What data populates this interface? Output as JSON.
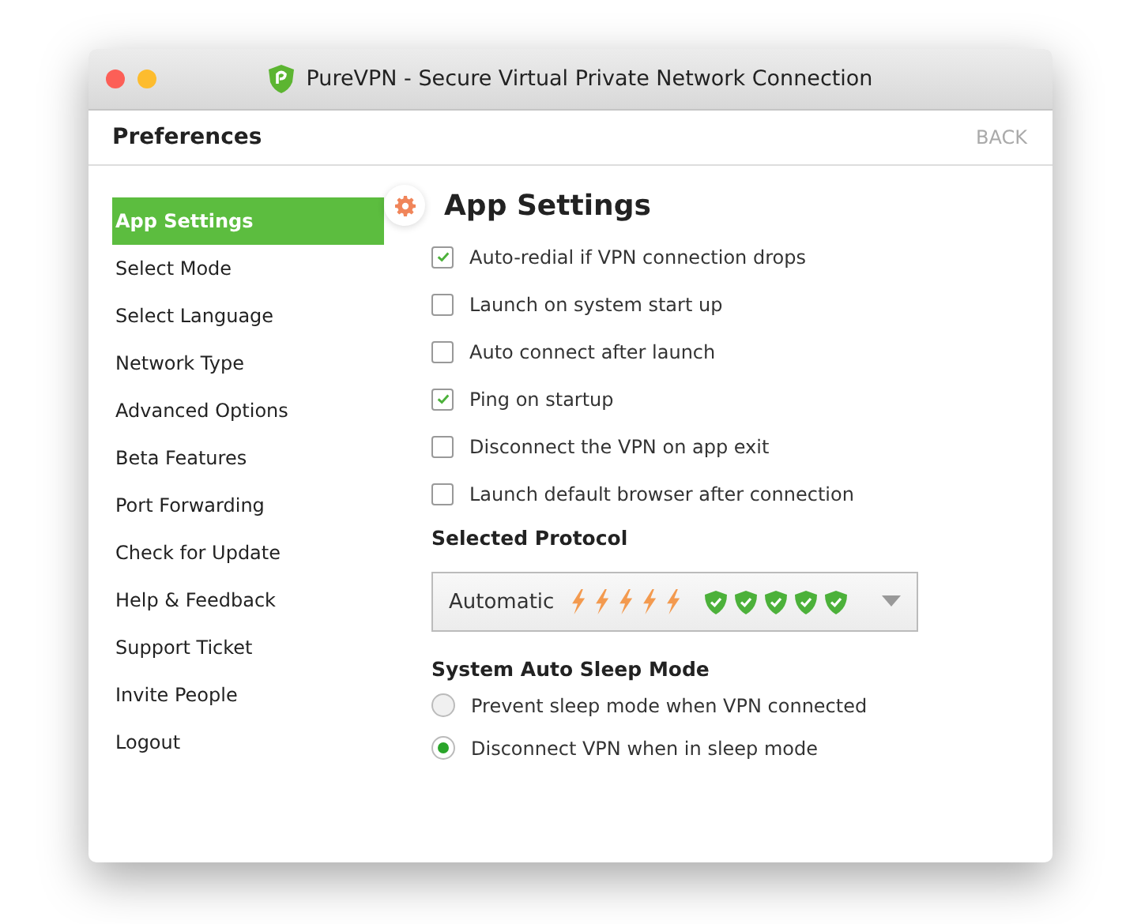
{
  "window": {
    "title": "PureVPN - Secure Virtual Private Network Connection"
  },
  "header": {
    "title": "Preferences",
    "back": "BACK"
  },
  "sidebar": {
    "items": [
      {
        "label": "App Settings",
        "selected": true
      },
      {
        "label": "Select Mode",
        "selected": false
      },
      {
        "label": "Select Language",
        "selected": false
      },
      {
        "label": "Network Type",
        "selected": false
      },
      {
        "label": "Advanced Options",
        "selected": false
      },
      {
        "label": "Beta Features",
        "selected": false
      },
      {
        "label": "Port Forwarding",
        "selected": false
      },
      {
        "label": "Check for Update",
        "selected": false
      },
      {
        "label": "Help & Feedback",
        "selected": false
      },
      {
        "label": "Support Ticket",
        "selected": false
      },
      {
        "label": "Invite People",
        "selected": false
      },
      {
        "label": "Logout",
        "selected": false
      }
    ]
  },
  "content": {
    "title": "App Settings",
    "options": [
      {
        "label": "Auto-redial if VPN connection drops",
        "checked": true
      },
      {
        "label": "Launch on system start up",
        "checked": false
      },
      {
        "label": "Auto connect after launch",
        "checked": false
      },
      {
        "label": "Ping on startup",
        "checked": true
      },
      {
        "label": "Disconnect the VPN on app exit",
        "checked": false
      },
      {
        "label": "Launch default browser after connection",
        "checked": false
      }
    ],
    "protocol": {
      "heading": "Selected Protocol",
      "value": "Automatic"
    },
    "sleep": {
      "heading": "System Auto Sleep Mode",
      "options": [
        {
          "label": "Prevent sleep mode when VPN connected",
          "selected": false
        },
        {
          "label": "Disconnect VPN when in sleep mode",
          "selected": true
        }
      ]
    }
  }
}
